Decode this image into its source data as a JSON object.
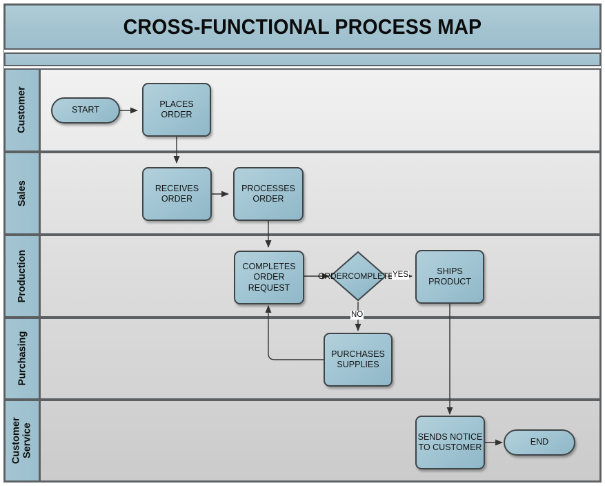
{
  "diagram": {
    "title": "CROSS-FUNCTIONAL PROCESS MAP",
    "type": "swimlane-flowchart",
    "colors": {
      "banner": "#a3c3d0",
      "lane_header": "#9fc2cf",
      "node_fill": "#a3c6d4",
      "node_border": "#3f4447",
      "connector": "#333333",
      "lane_border": "#5c6063"
    }
  },
  "lanes": [
    {
      "id": "customer",
      "label": "Customer"
    },
    {
      "id": "sales",
      "label": "Sales"
    },
    {
      "id": "production",
      "label": "Production"
    },
    {
      "id": "purchasing",
      "label": "Purchasing"
    },
    {
      "id": "customer_service",
      "label": "Customer\nService",
      "line1": "Customer",
      "line2": "Service"
    }
  ],
  "nodes": [
    {
      "id": "start",
      "lane": "customer",
      "shape": "terminator",
      "label": "START"
    },
    {
      "id": "places_order",
      "lane": "customer",
      "shape": "process",
      "line1": "PLACES",
      "line2": "ORDER"
    },
    {
      "id": "receives_order",
      "lane": "sales",
      "shape": "process",
      "line1": "RECEIVES",
      "line2": "ORDER"
    },
    {
      "id": "processes_order",
      "lane": "sales",
      "shape": "process",
      "line1": "PROCESSES",
      "line2": "ORDER"
    },
    {
      "id": "completes_order",
      "lane": "production",
      "shape": "process",
      "line1": "COMPLETES",
      "line2": "ORDER",
      "line3": "REQUEST"
    },
    {
      "id": "order_complete",
      "lane": "production",
      "shape": "decision",
      "line1": "ORDER",
      "line2": "COMPLETE?"
    },
    {
      "id": "ships_product",
      "lane": "production",
      "shape": "process",
      "line1": "SHIPS",
      "line2": "PRODUCT"
    },
    {
      "id": "purchases_supplies",
      "lane": "purchasing",
      "shape": "process",
      "line1": "PURCHASES",
      "line2": "SUPPLIES"
    },
    {
      "id": "sends_notice",
      "lane": "customer_service",
      "shape": "process",
      "line1": "SENDS NOTICE",
      "line2": "TO CUSTOMER"
    },
    {
      "id": "end",
      "lane": "customer_service",
      "shape": "terminator",
      "label": "END"
    }
  ],
  "edges": [
    {
      "from": "start",
      "to": "places_order",
      "label": ""
    },
    {
      "from": "places_order",
      "to": "receives_order",
      "label": ""
    },
    {
      "from": "receives_order",
      "to": "processes_order",
      "label": ""
    },
    {
      "from": "processes_order",
      "to": "completes_order",
      "label": ""
    },
    {
      "from": "completes_order",
      "to": "order_complete",
      "label": ""
    },
    {
      "from": "order_complete",
      "to": "ships_product",
      "label": "YES"
    },
    {
      "from": "order_complete",
      "to": "purchases_supplies",
      "label": "NO"
    },
    {
      "from": "purchases_supplies",
      "to": "completes_order",
      "label": ""
    },
    {
      "from": "ships_product",
      "to": "sends_notice",
      "label": ""
    },
    {
      "from": "sends_notice",
      "to": "end",
      "label": ""
    }
  ],
  "edge_labels": {
    "yes": "YES",
    "no": "NO"
  }
}
